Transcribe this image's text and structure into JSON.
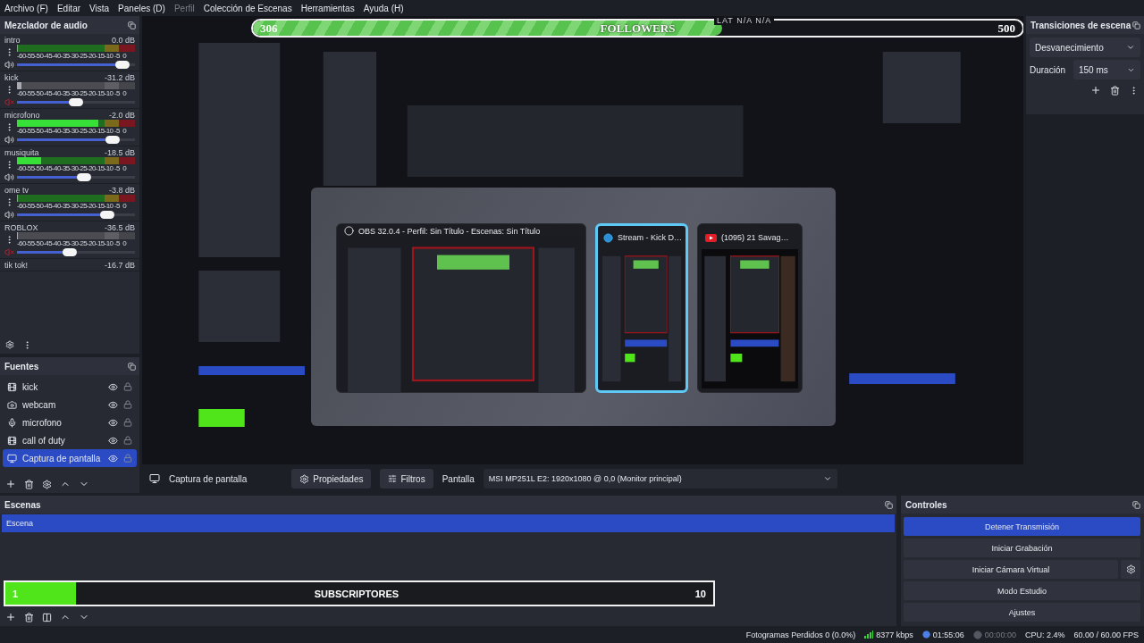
{
  "menu": [
    {
      "label": "Archivo (F)",
      "disabled": false
    },
    {
      "label": "Editar",
      "disabled": false
    },
    {
      "label": "Vista",
      "disabled": false
    },
    {
      "label": "Paneles (D)",
      "disabled": false
    },
    {
      "label": "Perfil",
      "disabled": true
    },
    {
      "label": "Colección de Escenas",
      "disabled": false
    },
    {
      "label": "Herramientas",
      "disabled": false
    },
    {
      "label": "Ayuda (H)",
      "disabled": false
    }
  ],
  "mixer": {
    "title": "Mezclador de audio",
    "channels": [
      {
        "name": "intro",
        "reading": "0.0 dB",
        "scale": "-60-55-50-45-40-35-30-25-20-15-10 -5  0",
        "meter": {
          "level": 0.0
        },
        "volume": {
          "level": 0.95
        },
        "muted": false
      },
      {
        "name": "kick",
        "reading": "-31.2 dB",
        "scale": "-60-55-50-45-40-35-30-25-20-15-10 -5  0",
        "meter": {
          "level": 0.03
        },
        "volume": {
          "level": 0.5
        },
        "muted": true
      },
      {
        "name": "microfono",
        "reading": "-2.0 dB",
        "scale": "-60-55-50-45-40-35-30-25-20-15-10 -5  0",
        "meter": {
          "level": 0.68
        },
        "volume": {
          "level": 0.85
        },
        "muted": false
      },
      {
        "name": "musiquita",
        "reading": "-18.5 dB",
        "scale": "-60-55-50-45-40-35-30-25-20-15-10 -5  0",
        "meter": {
          "level": 0.2
        },
        "volume": {
          "level": 0.58
        },
        "muted": false
      },
      {
        "name": "ome tv",
        "reading": "-3.8 dB",
        "scale": "-60-55-50-45-40-35-30-25-20-15-10 -5  0",
        "meter": {
          "level": 0.0
        },
        "volume": {
          "level": 0.8
        },
        "muted": false
      },
      {
        "name": "ROBLOX",
        "reading": "-36.5 dB",
        "scale": "-60-55-50-45-40-35-30-25-20-15-10 -5  0",
        "meter": {
          "level": 0.0
        },
        "volume": {
          "level": 0.44
        },
        "muted": true
      },
      {
        "name": "tik tok!",
        "reading": "-16.7 dB"
      }
    ]
  },
  "sources": {
    "title": "Fuentes",
    "items": [
      {
        "kind": "media",
        "name": "kick",
        "visible": true,
        "selected": false
      },
      {
        "kind": "camera",
        "name": "webcam",
        "visible": true,
        "selected": false
      },
      {
        "kind": "mic",
        "name": "microfono",
        "visible": true,
        "selected": false
      },
      {
        "kind": "media",
        "name": "call of duty",
        "visible": true,
        "selected": false
      },
      {
        "kind": "screen",
        "name": "Captura de pantalla",
        "visible": true,
        "selected": true
      }
    ]
  },
  "preview": {
    "latency": "LAT  N/A  N/A",
    "followers": {
      "current": "306",
      "label": "FOLLOWERS",
      "goal": "500",
      "level": 0.61
    },
    "switcher": [
      {
        "kind": "obs",
        "title": "OBS 32.0.4 - Perfil: Sin Título - Escenas: Sin Título",
        "selected": false
      },
      {
        "kind": "browser",
        "title": "Stream - Kick D…",
        "selected": true
      },
      {
        "kind": "video",
        "title": "(1095) 21 Savag…",
        "selected": false
      }
    ]
  },
  "source_toolbar": {
    "source": "Captura de pantalla",
    "properties": "Propiedades",
    "filters": "Filtros",
    "display_label": "Pantalla",
    "display_value": "MSI MP251L E2: 1920x1080 @ 0,0 (Monitor principal)"
  },
  "transitions": {
    "title": "Transiciones de escena",
    "transition": "Desvanecimiento",
    "duration_label": "Duración",
    "duration": "150 ms"
  },
  "scenes": {
    "title": "Escenas",
    "items": [
      {
        "name": "Escena",
        "selected": true
      }
    ],
    "subscribers": {
      "current": "1",
      "label": "SUBSCRIPTORES",
      "goal": "10",
      "level": 0.1
    }
  },
  "controls": {
    "title": "Controles",
    "buttons": [
      {
        "label": "Detener Transmisión",
        "active": true,
        "settings": false
      },
      {
        "label": "Iniciar Grabación",
        "active": false,
        "settings": false
      },
      {
        "label": "Iniciar Cámara Virtual",
        "active": false,
        "settings": true
      },
      {
        "label": "Modo Estudio",
        "active": false,
        "settings": false
      },
      {
        "label": "Ajustes",
        "active": false,
        "settings": false
      }
    ]
  },
  "status_bar": {
    "dropped": "Fotogramas Perdidos 0 (0.0%)",
    "bitrate": "8377 kbps",
    "stream_time": "01:55:06",
    "record_time": "00:00:00",
    "cpu": "CPU: 2.4%",
    "fps": "60.00 / 60.00 FPS"
  }
}
